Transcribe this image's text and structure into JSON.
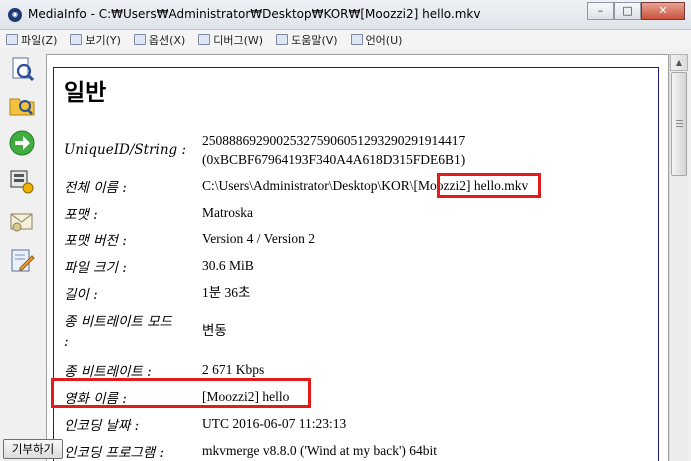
{
  "window": {
    "app_icon": "◉",
    "title": "MediaInfo - C:₩Users₩Administrator₩Desktop₩KOR₩[Moozzi2] hello.mkv",
    "minimize": "–",
    "maximize": "□",
    "close": "✕"
  },
  "menu": [
    {
      "icon": "file-menu-icon",
      "label": "파일(Z)"
    },
    {
      "icon": "view-menu-icon",
      "label": "보기(Y)"
    },
    {
      "icon": "options-menu-icon",
      "label": "옵션(X)"
    },
    {
      "icon": "debug-menu-icon",
      "label": "디버그(W)"
    },
    {
      "icon": "help-menu-icon",
      "label": "도움말(V)"
    },
    {
      "icon": "language-menu-icon",
      "label": "언어(U)"
    }
  ],
  "toolbar_icons": [
    "open-file-icon",
    "open-folder-icon",
    "next-arrow-icon",
    "export-icon",
    "send-email-icon",
    "edit-icon"
  ],
  "section": {
    "title": "일반"
  },
  "rows": [
    {
      "label": "UniqueID/String :",
      "value": "250888692900253275906051293290291914417",
      "value2": "(0xBCBF67964193F340A4A618D315FDE6B1)"
    },
    {
      "label": "전체 이름 :",
      "value": "C:\\Users\\Administrator\\Desktop\\KOR\\[Moozzi2] hello.mkv"
    },
    {
      "label": "포맷 :",
      "value": "Matroska"
    },
    {
      "label": "포맷 버전 :",
      "value": "Version 4 / Version 2"
    },
    {
      "label": "파일 크기 :",
      "value": "30.6 MiB"
    },
    {
      "label": "길이 :",
      "value": "1분 36초"
    },
    {
      "label": "종 비트레이트 모드 :",
      "label_line1": "종 비트레이트 모드",
      "label_line2": ":",
      "value": "변동"
    },
    {
      "label": "종 비트레이트 :",
      "value": "2 671 Kbps"
    },
    {
      "label": "영화 이름 :",
      "value": "[Moozzi2] hello"
    },
    {
      "label": "인코딩 날짜 :",
      "value": "UTC 2016-06-07 11:23:13"
    },
    {
      "label": "인코딩 프로그램 :",
      "value": "mkvmerge v8.8.0 ('Wind at my back') 64bit"
    }
  ],
  "donate_button": "기부하기",
  "colors": {
    "highlight": "#e31b1b",
    "frame": "#1e1e8a"
  }
}
